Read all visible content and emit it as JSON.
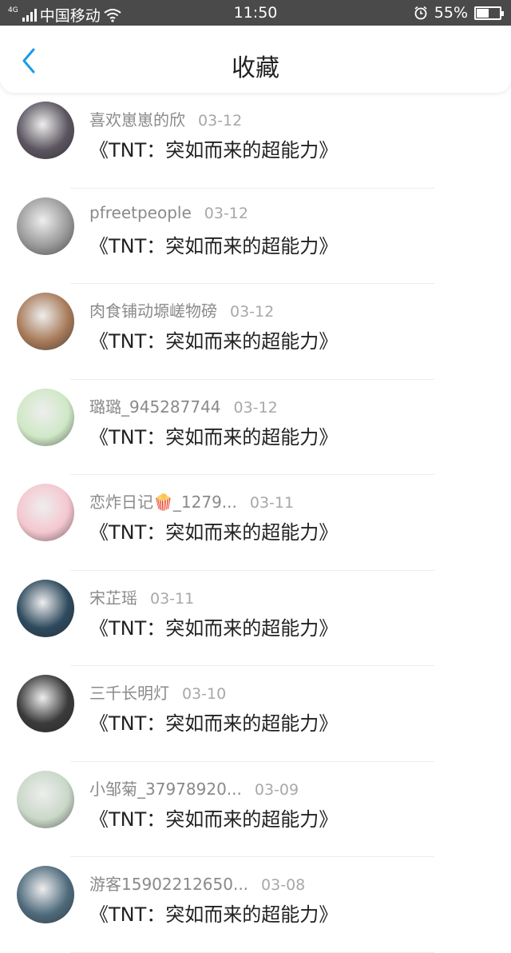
{
  "status_bar": {
    "network": "4G",
    "carrier": "中国移动",
    "time": "11:50",
    "battery": "55%",
    "battery_level": 0.55
  },
  "header": {
    "title": "收藏",
    "accent_color": "#1a9be8"
  },
  "items": [
    {
      "user": "喜欢崽崽的欣",
      "date": "03-12",
      "work": "《TNT：突如而来的超能力》",
      "avatar_color": "#5b5560"
    },
    {
      "user": "pfreetpeople",
      "date": "03-12",
      "work": "《TNT：突如而来的超能力》",
      "avatar_color": "#9a9a9a"
    },
    {
      "user": "肉食铺动塬嵯物磅",
      "date": "03-12",
      "work": "《TNT：突如而来的超能力》",
      "avatar_color": "#a87b5a"
    },
    {
      "user": "璐璐_945287744",
      "date": "03-12",
      "work": "《TNT：突如而来的超能力》",
      "avatar_color": "#cfe8c6"
    },
    {
      "user": "恋炸日记🍿_1279...",
      "date": "03-11",
      "work": "《TNT：突如而来的超能力》",
      "avatar_color": "#f4c7cf"
    },
    {
      "user": "宋芷瑶",
      "date": "03-11",
      "work": "《TNT：突如而来的超能力》",
      "avatar_color": "#2e4a5e"
    },
    {
      "user": "三千长明灯",
      "date": "03-10",
      "work": "《TNT：突如而来的超能力》",
      "avatar_color": "#3a3a3a"
    },
    {
      "user": "小邹菊_37978920...",
      "date": "03-09",
      "work": "《TNT：突如而来的超能力》",
      "avatar_color": "#c9d8c8"
    },
    {
      "user": "游客15902212650...",
      "date": "03-08",
      "work": "《TNT：突如而来的超能力》",
      "avatar_color": "#4f6b7d"
    }
  ]
}
